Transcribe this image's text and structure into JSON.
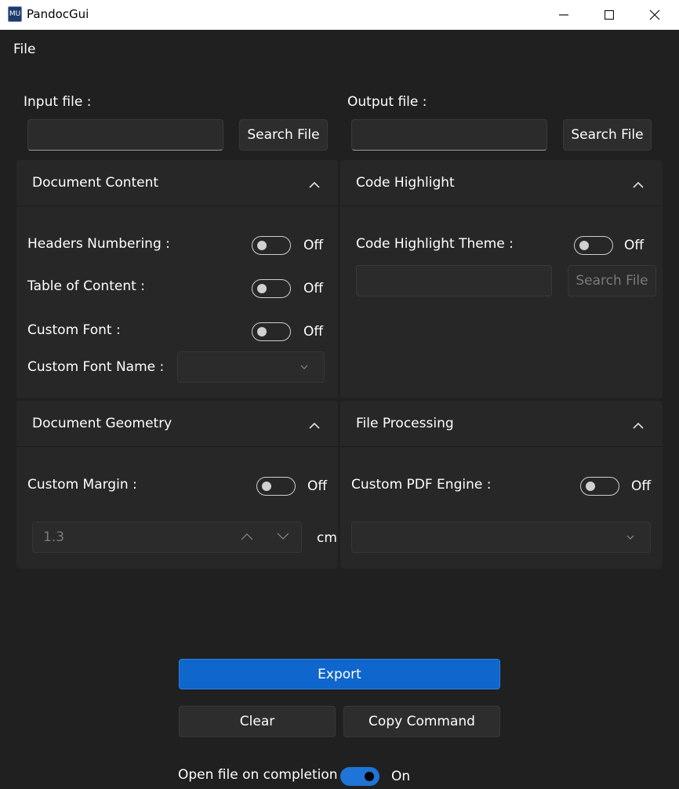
{
  "window": {
    "title": "PandocGui",
    "icon_label": "MU"
  },
  "menu": {
    "file_label": "File"
  },
  "input": {
    "label": "Input file :",
    "value": "",
    "search_button": "Search File"
  },
  "output": {
    "label": "Output file :",
    "value": "",
    "search_button": "Search File"
  },
  "panels": {
    "document_content": {
      "title": "Document Content",
      "headers_numbering_label": "Headers Numbering :",
      "headers_numbering_state": "Off",
      "table_of_content_label": "Table of Content :",
      "table_of_content_state": "Off",
      "custom_font_label": "Custom Font :",
      "custom_font_state": "Off",
      "custom_font_name_label": "Custom Font Name :",
      "custom_font_name_value": ""
    },
    "code_highlight": {
      "title": "Code Highlight",
      "theme_label": "Code Highlight Theme :",
      "theme_state": "Off",
      "theme_value": "",
      "search_button": "Search File"
    },
    "document_geometry": {
      "title": "Document Geometry",
      "custom_margin_label": "Custom Margin :",
      "custom_margin_state": "Off",
      "margin_value": "1.3",
      "margin_unit": "cm"
    },
    "file_processing": {
      "title": "File Processing",
      "pdf_engine_label": "Custom PDF Engine :",
      "pdf_engine_state": "Off",
      "pdf_engine_value": ""
    }
  },
  "actions": {
    "export_label": "Export",
    "clear_label": "Clear",
    "copy_command_label": "Copy Command",
    "open_on_completion_label": "Open file on completion :",
    "open_on_completion_state": "On"
  },
  "colors": {
    "accent": "#0f66cc",
    "background": "#202020",
    "panel": "#272727"
  }
}
